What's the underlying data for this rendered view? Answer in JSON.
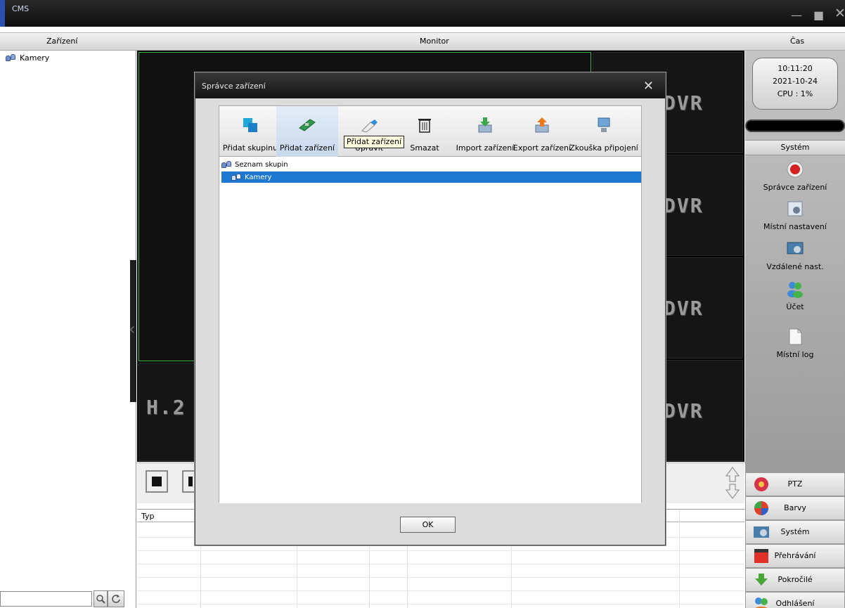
{
  "window": {
    "title": "CMS",
    "controls": [
      "—",
      "■",
      "✕"
    ]
  },
  "header": {
    "left": "Zařízení",
    "center": "Monitor",
    "right": "Čas"
  },
  "tree": {
    "root": "Kamery"
  },
  "monitor": {
    "overlay_text": "DVR",
    "watermark_text": "H.2"
  },
  "log_table": {
    "columns": [
      "Typ"
    ]
  },
  "clock": {
    "time": "10:11:20",
    "date": "2021-10-24",
    "cpu": "CPU : 1%"
  },
  "right_panel": {
    "section_title": "Systém",
    "items": [
      {
        "label": "Správce zařízení",
        "icon": "record-icon"
      },
      {
        "label": "Místní nastavení",
        "icon": "local-settings-icon"
      },
      {
        "label": "Vzdálené nast.",
        "icon": "remote-settings-icon"
      },
      {
        "label": "Účet",
        "icon": "account-icon"
      },
      {
        "label": "Místní log",
        "icon": "document-icon"
      }
    ],
    "bottom_buttons": [
      {
        "label": "PTZ",
        "icon": "ptz-icon"
      },
      {
        "label": "Barvy",
        "icon": "color-icon"
      },
      {
        "label": "Systém",
        "icon": "system-icon"
      },
      {
        "label": "Přehrávání",
        "icon": "playback-icon"
      },
      {
        "label": "Pokročilé",
        "icon": "advanced-icon"
      },
      {
        "label": "Odhlášení",
        "icon": "logout-icon"
      }
    ]
  },
  "dialog": {
    "title": "Správce zařízení",
    "close": "✕",
    "toolbar": [
      {
        "label": "Přidat skupinu",
        "icon": "add-group-icon"
      },
      {
        "label": "Přidat zařízení",
        "icon": "add-device-icon"
      },
      {
        "label": "Upravit",
        "icon": "edit-icon"
      },
      {
        "label": "Smazat",
        "icon": "delete-icon"
      },
      {
        "label": "Import zařízení",
        "icon": "import-icon"
      },
      {
        "label": "Export zařízení",
        "icon": "export-icon"
      },
      {
        "label": "Zkouška připojení",
        "icon": "connection-test-icon"
      }
    ],
    "tooltip": "Přidat zařízení",
    "group_list": {
      "root": "Seznam skupin",
      "selected": "Kamery"
    },
    "ok_label": "OK"
  },
  "colors": {
    "selection": "#1c78d0",
    "focus_border": "#3fb43f"
  }
}
